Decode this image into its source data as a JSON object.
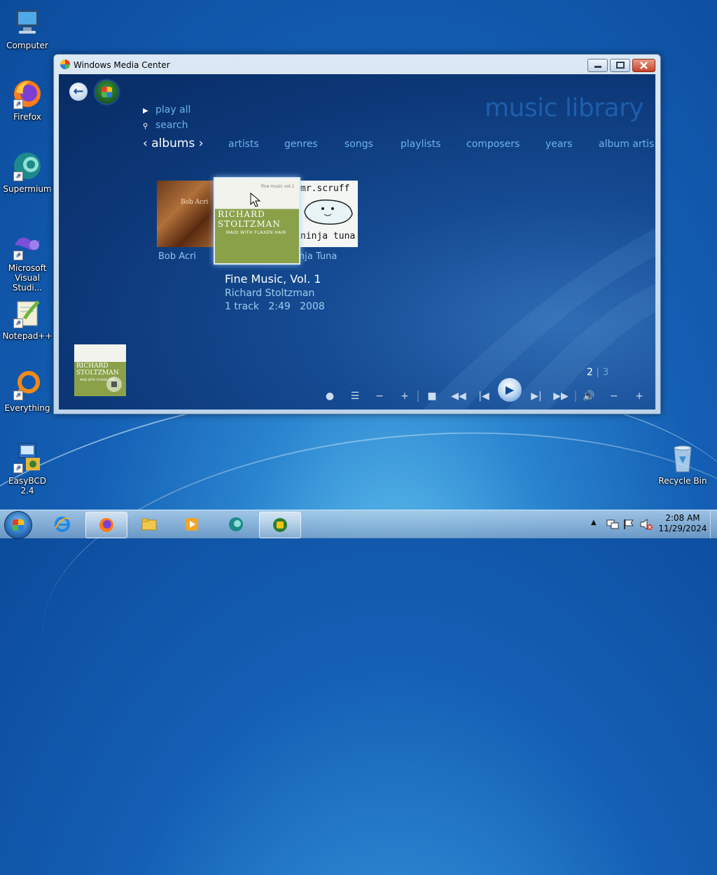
{
  "desktop": {
    "icons": [
      {
        "label": "Computer",
        "icon": "computer-icon"
      },
      {
        "label": "Firefox",
        "icon": "firefox-icon"
      },
      {
        "label": "Supermium",
        "icon": "supermium-icon"
      },
      {
        "label": "Microsoft Visual Studio Code",
        "label_line1": "Microsoft",
        "label_line2": "Visual Studi...",
        "icon": "vscode-icon"
      },
      {
        "label": "Notepad++",
        "icon": "notepadpp-icon"
      },
      {
        "label": "Everything",
        "icon": "everything-icon"
      },
      {
        "label": "EasyBCD 2.4",
        "icon": "easybcd-icon"
      },
      {
        "label": "Recycle Bin",
        "icon": "recycle-bin-icon"
      }
    ]
  },
  "window": {
    "title": "Windows Media Center"
  },
  "mediacenter": {
    "section_title": "music library",
    "menu": [
      {
        "label": "play all",
        "icon": "play-arrow-icon"
      },
      {
        "label": "search",
        "icon": "search-icon"
      }
    ],
    "tabs": [
      "albums",
      "artists",
      "genres",
      "songs",
      "playlists",
      "composers",
      "years",
      "album artis"
    ],
    "active_tab": "albums",
    "albums": [
      {
        "label": "Bob Acri",
        "cover_text": "Bob Acri"
      },
      {
        "label": "",
        "cover_text_small": "fine music vol.1",
        "cover_line1": "RICHARD",
        "cover_line2": "STOLTZMAN",
        "cover_subtitle": "MAID WITH FLAXEN HAIR"
      },
      {
        "label": "Ninja Tuna",
        "label_visible": "nja Tuna",
        "cover_text": "mr.scruff",
        "cover_text2": "ninja tuna"
      }
    ],
    "selected": {
      "title": "Fine Music, Vol. 1",
      "artist": "Richard Stoltzman",
      "meta": "1 track   2:49   2008"
    },
    "now_playing": {
      "line1": "RICHARD",
      "line2": "STOLTZMAN",
      "sub": "MAID WITH FLAXEN HAIR"
    },
    "pager": {
      "current": "2",
      "total": "3"
    },
    "controls": [
      "record",
      "guide",
      "channel-down",
      "channel-up",
      "stop",
      "rewind",
      "previous",
      "play",
      "next",
      "fast-forward",
      "volume",
      "volume-down",
      "volume-up"
    ],
    "accent_color": "#6cb3ea"
  },
  "taskbar": {
    "items": [
      "start",
      "internet-explorer",
      "firefox",
      "explorer",
      "media-player",
      "supermium",
      "windows-media-center"
    ],
    "clock_time": "2:08 AM",
    "clock_date": "11/29/2024"
  }
}
